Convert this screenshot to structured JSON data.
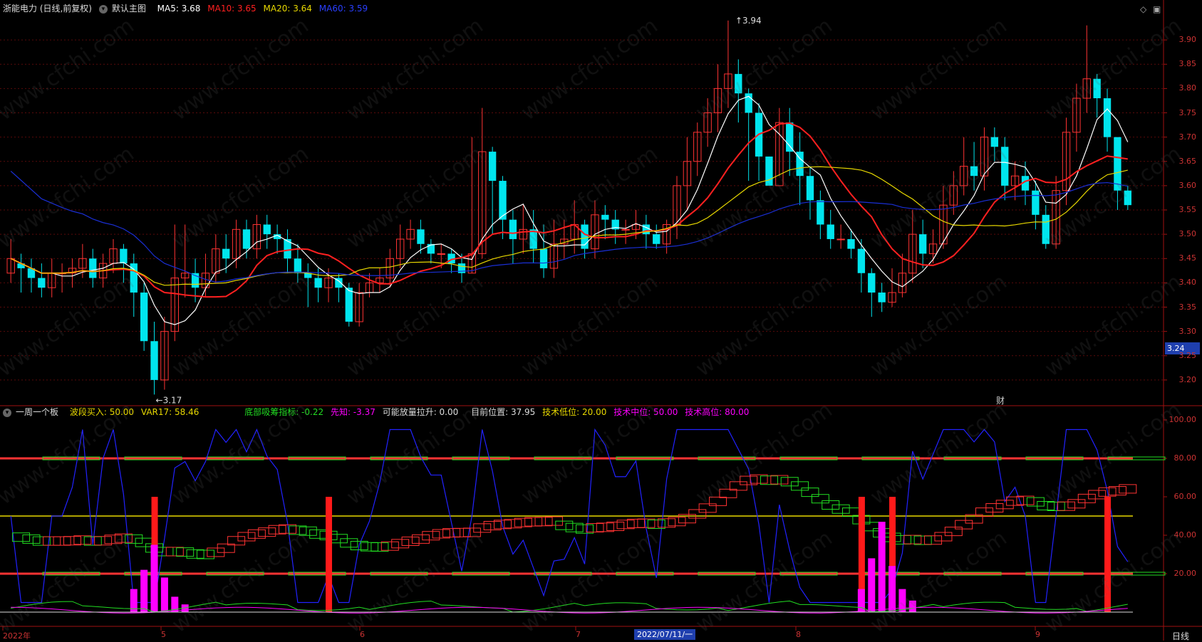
{
  "header_main": {
    "title": "浙能电力 (日线,前复权)",
    "template": "默认主图",
    "ma5": "MA5: 3.68",
    "ma10": "MA10: 3.65",
    "ma20": "MA20: 3.64",
    "ma60": "MA60: 3.59"
  },
  "header_sub": {
    "title": "一周一个板",
    "bodu": "波段买入: 50.00",
    "var17": "VAR17: 58.46",
    "dibu": "底部吸筹指标: -0.22",
    "xianzhi": "先知: -3.37",
    "fangliang": "可能放量拉升: 0.00",
    "position": "目前位置: 37.95",
    "low": "技术低位: 20.00",
    "mid": "技术中位: 50.00",
    "high": "技术高位: 80.00"
  },
  "price_axis": [
    "3.90",
    "3.85",
    "3.80",
    "3.75",
    "3.70",
    "3.65",
    "3.60",
    "3.55",
    "3.50",
    "3.45",
    "3.40",
    "3.35",
    "3.30",
    "3.25",
    "3.20"
  ],
  "sub_axis": [
    "100.00",
    "80.00",
    "60.00",
    "40.00",
    "20.00"
  ],
  "current_price": "3.24",
  "annotations": {
    "high": "3.94",
    "low": "3.17",
    "cai": "财"
  },
  "x_labels": [
    "2022年",
    "5",
    "6",
    "7",
    "8",
    "9"
  ],
  "cursor_date": "2022/07/11/一",
  "period": "日线",
  "watermark": "www.cfchi.com",
  "colors": {
    "up": "#ff3333",
    "down": "#00e5ee",
    "ma5": "#ffffff",
    "ma10": "#ff2020",
    "ma20": "#e8d800",
    "ma60": "#1a2fd6",
    "magenta": "#ff00ff",
    "green": "#22dd22",
    "blue": "#2222ff"
  },
  "chart_data": [
    {
      "type": "candlestick",
      "title": "浙能电力 (日线,前复权)",
      "ylim": [
        3.15,
        3.95
      ],
      "candles": [
        [
          3.42,
          3.45,
          3.49,
          3.4
        ],
        [
          3.44,
          3.43,
          3.46,
          3.38
        ],
        [
          3.43,
          3.41,
          3.45,
          3.38
        ],
        [
          3.41,
          3.39,
          3.44,
          3.37
        ],
        [
          3.39,
          3.42,
          3.45,
          3.37
        ],
        [
          3.42,
          3.42,
          3.44,
          3.38
        ],
        [
          3.42,
          3.43,
          3.45,
          3.39
        ],
        [
          3.43,
          3.45,
          3.48,
          3.41
        ],
        [
          3.45,
          3.41,
          3.47,
          3.39
        ],
        [
          3.41,
          3.44,
          3.46,
          3.39
        ],
        [
          3.44,
          3.47,
          3.49,
          3.42
        ],
        [
          3.47,
          3.44,
          3.48,
          3.4
        ],
        [
          3.44,
          3.38,
          3.46,
          3.33
        ],
        [
          3.38,
          3.28,
          3.4,
          3.26
        ],
        [
          3.28,
          3.2,
          3.32,
          3.17
        ],
        [
          3.2,
          3.3,
          3.33,
          3.18
        ],
        [
          3.3,
          3.41,
          3.52,
          3.28
        ],
        [
          3.41,
          3.42,
          3.52,
          3.37
        ],
        [
          3.42,
          3.39,
          3.45,
          3.36
        ],
        [
          3.39,
          3.42,
          3.46,
          3.37
        ],
        [
          3.42,
          3.47,
          3.5,
          3.4
        ],
        [
          3.47,
          3.45,
          3.5,
          3.42
        ],
        [
          3.45,
          3.51,
          3.53,
          3.43
        ],
        [
          3.51,
          3.47,
          3.53,
          3.45
        ],
        [
          3.47,
          3.52,
          3.54,
          3.45
        ],
        [
          3.52,
          3.5,
          3.54,
          3.47
        ],
        [
          3.5,
          3.49,
          3.52,
          3.46
        ],
        [
          3.49,
          3.45,
          3.51,
          3.42
        ],
        [
          3.45,
          3.42,
          3.48,
          3.4
        ],
        [
          3.42,
          3.41,
          3.44,
          3.35
        ],
        [
          3.41,
          3.39,
          3.43,
          3.36
        ],
        [
          3.39,
          3.41,
          3.43,
          3.36
        ],
        [
          3.41,
          3.39,
          3.42,
          3.36
        ],
        [
          3.39,
          3.32,
          3.4,
          3.31
        ],
        [
          3.32,
          3.38,
          3.4,
          3.31
        ],
        [
          3.38,
          3.4,
          3.42,
          3.37
        ],
        [
          3.4,
          3.41,
          3.43,
          3.38
        ],
        [
          3.41,
          3.45,
          3.47,
          3.39
        ],
        [
          3.45,
          3.49,
          3.52,
          3.43
        ],
        [
          3.49,
          3.51,
          3.53,
          3.47
        ],
        [
          3.51,
          3.48,
          3.53,
          3.46
        ],
        [
          3.48,
          3.46,
          3.49,
          3.44
        ],
        [
          3.46,
          3.46,
          3.48,
          3.43
        ],
        [
          3.46,
          3.44,
          3.47,
          3.42
        ],
        [
          3.44,
          3.42,
          3.46,
          3.4
        ],
        [
          3.42,
          3.46,
          3.7,
          3.42
        ],
        [
          3.46,
          3.67,
          3.76,
          3.45
        ],
        [
          3.67,
          3.61,
          3.68,
          3.5
        ],
        [
          3.61,
          3.53,
          3.62,
          3.49
        ],
        [
          3.53,
          3.49,
          3.55,
          3.44
        ],
        [
          3.49,
          3.51,
          3.56,
          3.46
        ],
        [
          3.51,
          3.47,
          3.55,
          3.44
        ],
        [
          3.47,
          3.43,
          3.52,
          3.41
        ],
        [
          3.43,
          3.48,
          3.53,
          3.41
        ],
        [
          3.48,
          3.49,
          3.53,
          3.45
        ],
        [
          3.49,
          3.52,
          3.57,
          3.46
        ],
        [
          3.52,
          3.47,
          3.53,
          3.45
        ],
        [
          3.47,
          3.54,
          3.57,
          3.45
        ],
        [
          3.54,
          3.53,
          3.56,
          3.49
        ],
        [
          3.53,
          3.51,
          3.55,
          3.48
        ],
        [
          3.51,
          3.51,
          3.53,
          3.48
        ],
        [
          3.51,
          3.52,
          3.55,
          3.49
        ],
        [
          3.52,
          3.5,
          3.54,
          3.47
        ],
        [
          3.5,
          3.48,
          3.52,
          3.47
        ],
        [
          3.48,
          3.52,
          3.53,
          3.46
        ],
        [
          3.52,
          3.6,
          3.62,
          3.49
        ],
        [
          3.6,
          3.65,
          3.7,
          3.55
        ],
        [
          3.65,
          3.71,
          3.73,
          3.62
        ],
        [
          3.71,
          3.75,
          3.78,
          3.68
        ],
        [
          3.75,
          3.8,
          3.85,
          3.71
        ],
        [
          3.8,
          3.83,
          3.94,
          3.76
        ],
        [
          3.83,
          3.79,
          3.86,
          3.73
        ],
        [
          3.79,
          3.75,
          3.8,
          3.61
        ],
        [
          3.75,
          3.66,
          3.77,
          3.61
        ],
        [
          3.66,
          3.6,
          3.66,
          3.62
        ],
        [
          3.6,
          3.73,
          3.76,
          3.62
        ],
        [
          3.73,
          3.67,
          3.76,
          3.62
        ],
        [
          3.67,
          3.62,
          3.71,
          3.56
        ],
        [
          3.62,
          3.57,
          3.64,
          3.53
        ],
        [
          3.57,
          3.52,
          3.59,
          3.49
        ],
        [
          3.52,
          3.49,
          3.55,
          3.47
        ],
        [
          3.49,
          3.49,
          3.52,
          3.47
        ],
        [
          3.49,
          3.47,
          3.51,
          3.45
        ],
        [
          3.47,
          3.42,
          3.49,
          3.38
        ],
        [
          3.42,
          3.38,
          3.43,
          3.33
        ],
        [
          3.38,
          3.36,
          3.4,
          3.34
        ],
        [
          3.36,
          3.38,
          3.43,
          3.35
        ],
        [
          3.38,
          3.42,
          3.46,
          3.37
        ],
        [
          3.42,
          3.5,
          3.55,
          3.4
        ],
        [
          3.5,
          3.46,
          3.53,
          3.43
        ],
        [
          3.46,
          3.48,
          3.51,
          3.44
        ],
        [
          3.48,
          3.56,
          3.6,
          3.47
        ],
        [
          3.56,
          3.6,
          3.63,
          3.54
        ],
        [
          3.6,
          3.64,
          3.7,
          3.58
        ],
        [
          3.64,
          3.62,
          3.69,
          3.59
        ],
        [
          3.62,
          3.7,
          3.72,
          3.59
        ],
        [
          3.7,
          3.68,
          3.72,
          3.65
        ],
        [
          3.68,
          3.6,
          3.7,
          3.57
        ],
        [
          3.6,
          3.62,
          3.65,
          3.57
        ],
        [
          3.62,
          3.59,
          3.65,
          3.56
        ],
        [
          3.59,
          3.54,
          3.61,
          3.51
        ],
        [
          3.54,
          3.48,
          3.56,
          3.47
        ],
        [
          3.48,
          3.59,
          3.62,
          3.47
        ],
        [
          3.59,
          3.71,
          3.74,
          3.56
        ],
        [
          3.71,
          3.78,
          3.81,
          3.67
        ],
        [
          3.78,
          3.82,
          3.93,
          3.75
        ],
        [
          3.82,
          3.78,
          3.83,
          3.74
        ],
        [
          3.78,
          3.7,
          3.8,
          3.67
        ],
        [
          3.7,
          3.59,
          3.67,
          3.55
        ],
        [
          3.59,
          3.56,
          3.6,
          3.55
        ]
      ],
      "x_labels": [
        "2022年",
        "5",
        "6",
        "7",
        "8",
        "9"
      ]
    },
    {
      "type": "line",
      "title": "一周一个板",
      "ylim": [
        0,
        100
      ],
      "levels": [
        20,
        50,
        80
      ]
    }
  ]
}
